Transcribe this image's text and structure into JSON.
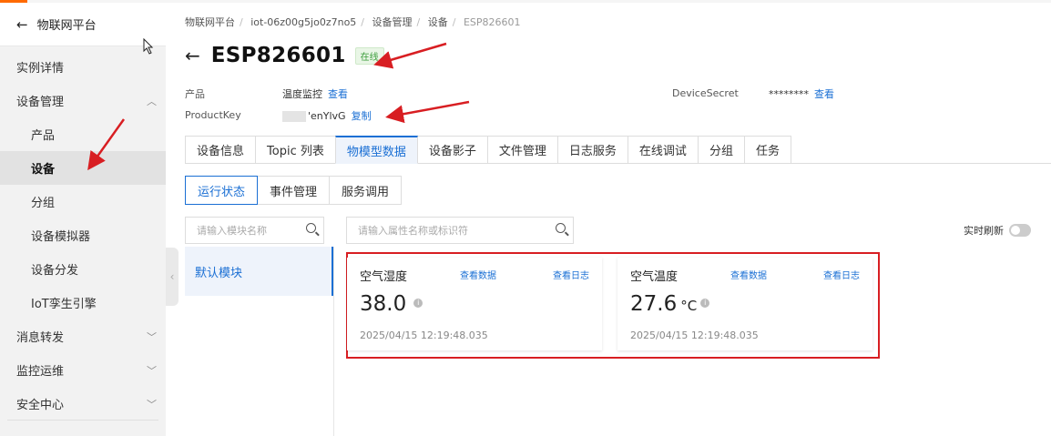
{
  "sidebar": {
    "back_label": "物联网平台",
    "items": [
      {
        "label": "实例详情"
      },
      {
        "label": "设备管理"
      },
      {
        "label": "产品"
      },
      {
        "label": "设备"
      },
      {
        "label": "分组"
      },
      {
        "label": "设备模拟器"
      },
      {
        "label": "设备分发"
      },
      {
        "label": "IoT孪生引擎"
      },
      {
        "label": "消息转发"
      },
      {
        "label": "监控运维"
      },
      {
        "label": "安全中心"
      }
    ]
  },
  "breadcrumb": [
    "物联网平台",
    "iot-06z00g5jo0z7no5",
    "设备管理",
    "设备",
    "ESP826601"
  ],
  "device": {
    "name": "ESP826601",
    "status": "在线",
    "product_label": "产品",
    "product_value": "温度监控",
    "product_link": "查看",
    "productkey_label": "ProductKey",
    "productkey_value": "'enYlvG",
    "productkey_link": "复制",
    "secret_label": "DeviceSecret",
    "secret_value": "********",
    "secret_link": "查看"
  },
  "tabs": [
    "设备信息",
    "Topic 列表",
    "物模型数据",
    "设备影子",
    "文件管理",
    "日志服务",
    "在线调试",
    "分组",
    "任务"
  ],
  "subtabs": [
    "运行状态",
    "事件管理",
    "服务调用"
  ],
  "module_search_placeholder": "请输入模块名称",
  "property_search_placeholder": "请输入属性名称或标识符",
  "realtime_label": "实时刷新",
  "realtime_on": false,
  "modules": [
    "默认模块"
  ],
  "properties": [
    {
      "name": "空气湿度",
      "view_data": "查看数据",
      "view_log": "查看日志",
      "value": "38.0",
      "unit": "",
      "time": "2025/04/15 12:19:48.035"
    },
    {
      "name": "空气温度",
      "view_data": "查看数据",
      "view_log": "查看日志",
      "value": "27.6",
      "unit": "°C",
      "time": "2025/04/15 12:19:48.035"
    }
  ],
  "colors": {
    "accent": "#1a6fd4",
    "online": "#3a9c3a",
    "annotation": "#d81e22"
  }
}
